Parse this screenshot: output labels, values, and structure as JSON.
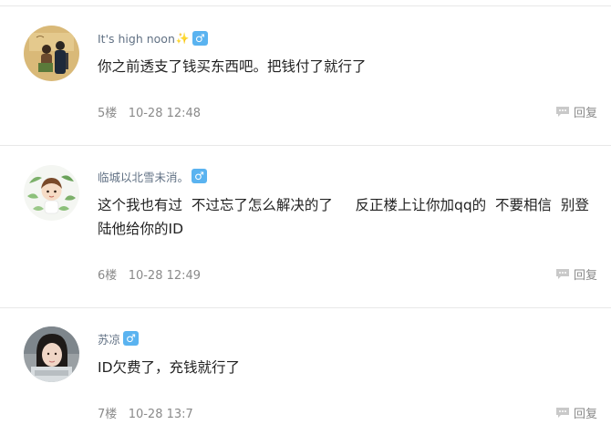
{
  "posts": [
    {
      "username": "It's high noon",
      "sparkle": "✨",
      "gender": "♂",
      "content": "你之前透支了钱买东西吧。把钱付了就行了",
      "floor": "5楼",
      "time": "10-28 12:48",
      "reply_label": "回复"
    },
    {
      "username": "临城以北雪未消。",
      "gender": "♂",
      "content": "这个我也有过  不过忘了怎么解决的了     反正楼上让你加qq的  不要相信  别登陆他给你的ID",
      "floor": "6楼",
      "time": "10-28 12:49",
      "reply_label": "回复"
    },
    {
      "username": "苏凉",
      "gender": "♂",
      "content": "ID欠费了，充钱就行了",
      "floor": "7楼",
      "time": "10-28 13:7",
      "reply_label": "回复"
    }
  ],
  "colors": {
    "username": "#617184",
    "badge": "#5ab3f0",
    "meta": "#8a8a8a",
    "divider": "#e8e8e8"
  }
}
